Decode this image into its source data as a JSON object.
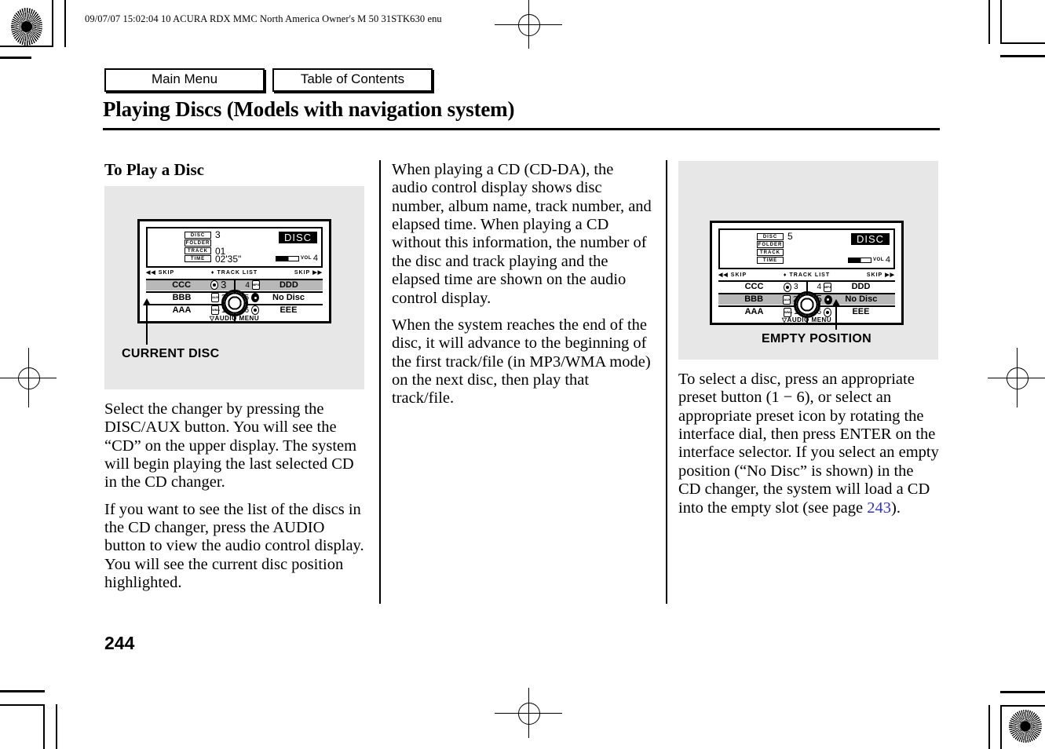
{
  "header": {
    "slug": "09/07/07 15:02:04    10 ACURA RDX MMC North America Owner's M 50 31STK630 enu"
  },
  "nav": {
    "main_menu": "Main Menu",
    "table_of_contents": "Table of Contents"
  },
  "page": {
    "title": "Playing Discs (Models with navigation system)",
    "number": "244"
  },
  "column1": {
    "subhead": "To Play a Disc",
    "caption": "CURRENT DISC",
    "para1": "Select the changer by pressing the DISC/AUX button. You will see the “CD” on the upper display. The system will begin playing the last selected CD in the CD changer.",
    "para2": "If you want to see the list of the discs in the CD changer, press the AUDIO button to view the audio control display. You will see the current disc position highlighted."
  },
  "column2": {
    "para1": "When playing a CD (CD-DA), the audio control display shows disc number, album name, track number, and elapsed time. When playing a CD without this information, the number of the disc and track playing and the elapsed time are shown on the audio control display.",
    "para2": "When the system reaches the end of the disc, it will advance to the beginning of the first track/file (in MP3/WMA mode) on the next disc, then play that track/file."
  },
  "column3": {
    "caption": "EMPTY POSITION",
    "para1_a": "To select a disc, press an appropriate preset button (1 − 6), or select an appropriate preset icon by rotating the interface dial, then press ENTER on the interface selector. If you select an empty position (“No Disc” is shown) in the CD changer, the system will load a CD into the empty slot (see page ",
    "para1_xref": "243",
    "para1_b": ")."
  },
  "radio1": {
    "lcd_labels": [
      "DISC",
      "FOLDER",
      "TRACK",
      "TIME"
    ],
    "lcd_disc": "3",
    "lcd_folder": "",
    "lcd_track": "01",
    "lcd_time": "02'35\"",
    "mode_badge": "DISC",
    "vol_label": "VOL",
    "vol_value": "4",
    "skip_left": "SKIP",
    "track_list": "TRACK LIST",
    "skip_right": "SKIP",
    "audio_menu": "AUDIO MENU",
    "presets": [
      {
        "left": "CCC",
        "left_num": "3",
        "right": "DDD",
        "right_num": "4",
        "highlight": true
      },
      {
        "left": "BBB",
        "left_num": "2",
        "right": "No Disc",
        "right_num": "5",
        "highlight": false
      },
      {
        "left": "AAA",
        "left_num": "1",
        "right": "EEE",
        "right_num": "6",
        "highlight": false
      }
    ]
  },
  "radio3": {
    "lcd_labels": [
      "DISC",
      "FOLDER",
      "TRACK",
      "TIME"
    ],
    "lcd_disc": "5",
    "lcd_folder": "",
    "lcd_track": "",
    "lcd_time": "",
    "mode_badge": "DISC",
    "vol_label": "VOL",
    "vol_value": "4",
    "skip_left": "SKIP",
    "track_list": "TRACK LIST",
    "skip_right": "SKIP",
    "audio_menu": "AUDIO MENU",
    "presets": [
      {
        "left": "CCC",
        "left_num": "3",
        "right": "DDD",
        "right_num": "4",
        "highlight": false
      },
      {
        "left": "BBB",
        "left_num": "2",
        "right": "No Disc",
        "right_num": "5",
        "highlight": true
      },
      {
        "left": "AAA",
        "left_num": "1",
        "right": "EEE",
        "right_num": "6",
        "highlight": false
      }
    ]
  },
  "colors": {
    "xref": "#3333cc",
    "illustration_bg": "#e7e7e7",
    "highlight": "#b8b8b8"
  }
}
